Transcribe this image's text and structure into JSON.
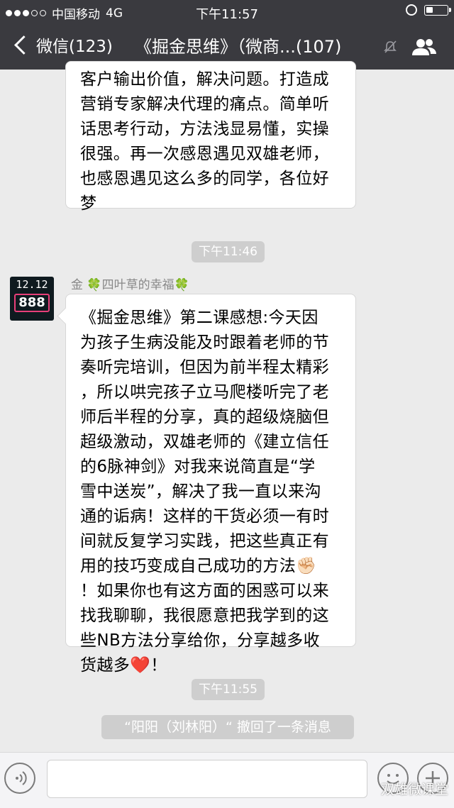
{
  "status": {
    "carrier": "中国移动",
    "network": "4G",
    "time": "下午11:57"
  },
  "nav": {
    "back_label": "微信(123)",
    "title": "《掘金思维》（微商...(107)"
  },
  "messages": {
    "partial": {
      "lines": [
        "客户输出价值，解决问题。打造成",
        "营销专家解决代理的痛点。简单听",
        "话思考行动，方法浅显易懂，实操",
        "很强。再一次感恩遇见双雄老师，",
        "也感恩遇见这么多的同学，各位好",
        "梦"
      ]
    },
    "time1": "下午11:46",
    "sender": {
      "name": "金 ",
      "clover": "🍀",
      "name2": "四叶草的幸福",
      "clover2": "🍀"
    },
    "avatar": {
      "line1": "12.12",
      "line2": "888"
    },
    "main": {
      "lines": [
        "《掘金思维》第二课感想:今天因",
        "为孩子生病没能及时跟着老师的节",
        "奏听完培训，但因为前半程太精彩",
        "，所以哄完孩子立马爬楼听完了老",
        "师后半程的分享，真的超级烧脑但",
        "超级激动，双雄老师的《建立信任",
        "的6脉神剑》对我来说简直是“学",
        "雪中送炭”，解决了我一直以来沟",
        "通的诟病！这样的干货必须一有时",
        "间就反复学习实践，把这些真正有",
        "用的技巧变成自己成功的方法✊🏻",
        "！如果你也有这方面的困惑可以来",
        "找我聊聊，我很愿意把我学到的这",
        "些NB方法分享给你，分享越多收",
        "货越多❤️！"
      ]
    },
    "time2": "下午11:55",
    "recall": "“阳阳（刘林阳）“ 撤回了一条消息"
  },
  "footer": {
    "watermark": "双雄微课堂"
  }
}
